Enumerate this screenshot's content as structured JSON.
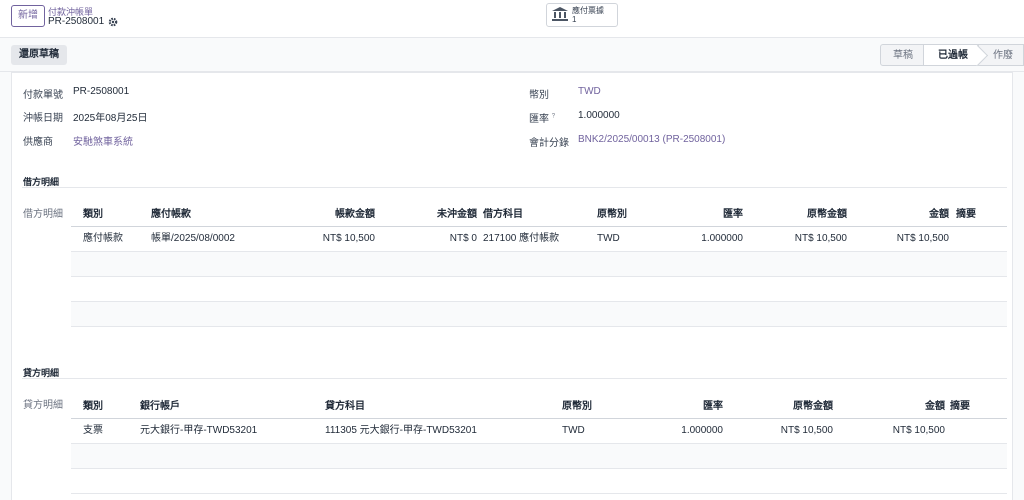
{
  "control_panel": {
    "new_label": "新增",
    "breadcrumb_parent": "付款沖帳單",
    "breadcrumb_current": "PR-2508001",
    "smart_button": {
      "label": "應付票據",
      "count": "1"
    }
  },
  "actions": {
    "revert_label": "還原草稿"
  },
  "status_bar": [
    "草稿",
    "已過帳",
    "作廢"
  ],
  "status_active_index": 1,
  "form": {
    "left": [
      {
        "label": "付款單號",
        "value": "PR-2508001",
        "link": false
      },
      {
        "label": "沖帳日期",
        "value": "2025年08月25日",
        "link": false
      },
      {
        "label": "供應商",
        "value": "安馳煞車系統",
        "link": true
      }
    ],
    "right": [
      {
        "label": "幣別",
        "value": "TWD",
        "link": true,
        "help": ""
      },
      {
        "label": "匯率",
        "value": "1.000000",
        "link": false,
        "help": "?"
      },
      {
        "label": "會計分錄",
        "value": "BNK2/2025/00013 (PR-2508001)",
        "link": true,
        "help": ""
      }
    ]
  },
  "debit": {
    "section_title": "借方明細",
    "side_label": "借方明細",
    "headers": [
      "類別",
      "應付帳款",
      "帳款金額",
      "未沖金額",
      "借方科目",
      "原幣別",
      "匯率",
      "原幣金額",
      "金額",
      "摘要"
    ],
    "rows": [
      [
        "應付帳款",
        "帳單/2025/08/0002",
        "NT$ 10,500",
        "NT$ 0",
        "217100 應付帳款",
        "TWD",
        "1.000000",
        "NT$ 10,500",
        "NT$ 10,500",
        ""
      ]
    ]
  },
  "credit": {
    "section_title": "貸方明細",
    "side_label": "貸方明細",
    "headers": [
      "類別",
      "銀行帳戶",
      "貸方科目",
      "原幣別",
      "匯率",
      "原幣金額",
      "金額",
      "摘要"
    ],
    "rows": [
      [
        "支票",
        "元大銀行-甲存-TWD53201",
        "111305 元大銀行-甲存-TWD53201",
        "TWD",
        "1.000000",
        "NT$ 10,500",
        "NT$ 10,500",
        ""
      ]
    ]
  },
  "colors": {
    "accent": "#71639e",
    "border": "#e5e7eb"
  },
  "icons": {
    "settings": "gear-icon",
    "smart_button": "bank-icon"
  }
}
